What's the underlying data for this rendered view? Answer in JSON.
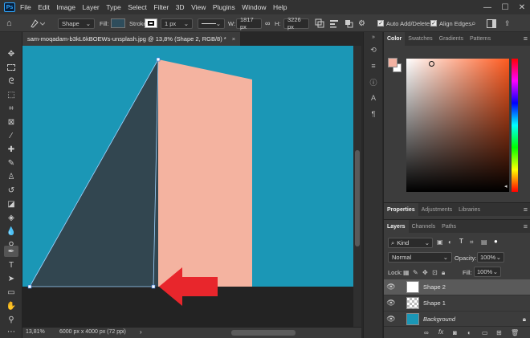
{
  "menubar": {
    "app_badge": "Ps",
    "items": [
      "File",
      "Edit",
      "Image",
      "Layer",
      "Type",
      "Select",
      "Filter",
      "3D",
      "View",
      "Plugins",
      "Window",
      "Help"
    ],
    "minimize": "—",
    "maximize": "☐",
    "close": "✕"
  },
  "options": {
    "mode_value": "Shape",
    "fill_label": "Fill:",
    "stroke_label": "Stroke:",
    "stroke_width": "1 px",
    "w_label": "W:",
    "w_value": "1817 px",
    "link_glyph": "∞",
    "h_label": "H:",
    "h_value": "3226 px",
    "auto_add_delete_label": "Auto Add/Delete",
    "align_edges_label": "Align Edges",
    "fill_color": "#2e4d5c"
  },
  "document": {
    "tab_title": "sam-moqadam-b3kL6kBOEWs-unsplash.jpg @ 13,8% (Shape 2, RGB/8) *",
    "close_glyph": "×",
    "canvas_bg": "#1b97b6",
    "shadow_color": "#324650",
    "wall_color": "#f4b3a0",
    "ground_color": "#232323",
    "arrow_color": "#e8262c"
  },
  "status": {
    "zoom": "13,81%",
    "doc_size": "6000 px x 4000 px (72 ppi)"
  },
  "color_panel": {
    "tabs": [
      "Color",
      "Swatches",
      "Gradients",
      "Patterns"
    ],
    "foreground": "#f2b2a2",
    "background": "#ffffff"
  },
  "properties_panel": {
    "tabs": [
      "Properties",
      "Adjustments",
      "Libraries"
    ]
  },
  "layers_panel": {
    "tabs": [
      "Layers",
      "Channels",
      "Paths"
    ],
    "filter_kind": "Kind",
    "blend_mode": "Normal",
    "opacity_label": "Opacity:",
    "opacity_value": "100%",
    "lock_label": "Lock:",
    "fill_label": "Fill:",
    "fill_value": "100%",
    "layers": [
      {
        "name": "Shape 2",
        "selected": true
      },
      {
        "name": "Shape 1",
        "selected": false
      },
      {
        "name": "Background",
        "selected": false
      }
    ],
    "fx_label": "fx"
  }
}
